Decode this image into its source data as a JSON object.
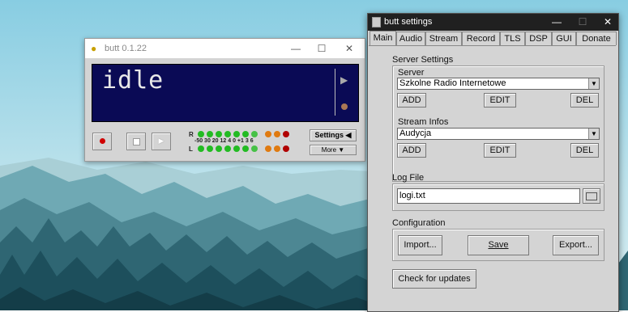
{
  "butt": {
    "title": "butt 0.1.22",
    "window_controls": {
      "minimize": "—",
      "maximize": "☐",
      "close": "✕"
    },
    "display_text": "idle",
    "vu": {
      "r_label": "R",
      "l_label": "L",
      "scale": "-50 30 20 12 4 0 +1 3 6"
    },
    "settings_button": "Settings",
    "more_button": "More"
  },
  "settings": {
    "title": "butt settings",
    "window_controls": {
      "minimize": "—",
      "maximize": "☐",
      "close": "✕"
    },
    "tabs": [
      "Main",
      "Audio",
      "Stream",
      "Record",
      "TLS",
      "DSP",
      "GUI",
      "Donate"
    ],
    "active_tab": "Main",
    "server_settings": {
      "heading": "Server Settings",
      "server": {
        "label": "Server",
        "value": "Szkolne Radio Internetowe",
        "add": "ADD",
        "edit": "EDIT",
        "del": "DEL"
      },
      "stream_infos": {
        "label": "Stream Infos",
        "value": "Audycja",
        "add": "ADD",
        "edit": "EDIT",
        "del": "DEL"
      }
    },
    "log_file": {
      "label": "Log File",
      "value": "logi.txt"
    },
    "configuration": {
      "label": "Configuration",
      "import": "Import...",
      "save": "Save",
      "export": "Export..."
    },
    "check_updates": "Check for updates"
  },
  "colors": {
    "display_bg": "#0a0a55",
    "led_green": "#22bb22",
    "led_orange": "#e07a10",
    "led_red": "#b00000"
  }
}
